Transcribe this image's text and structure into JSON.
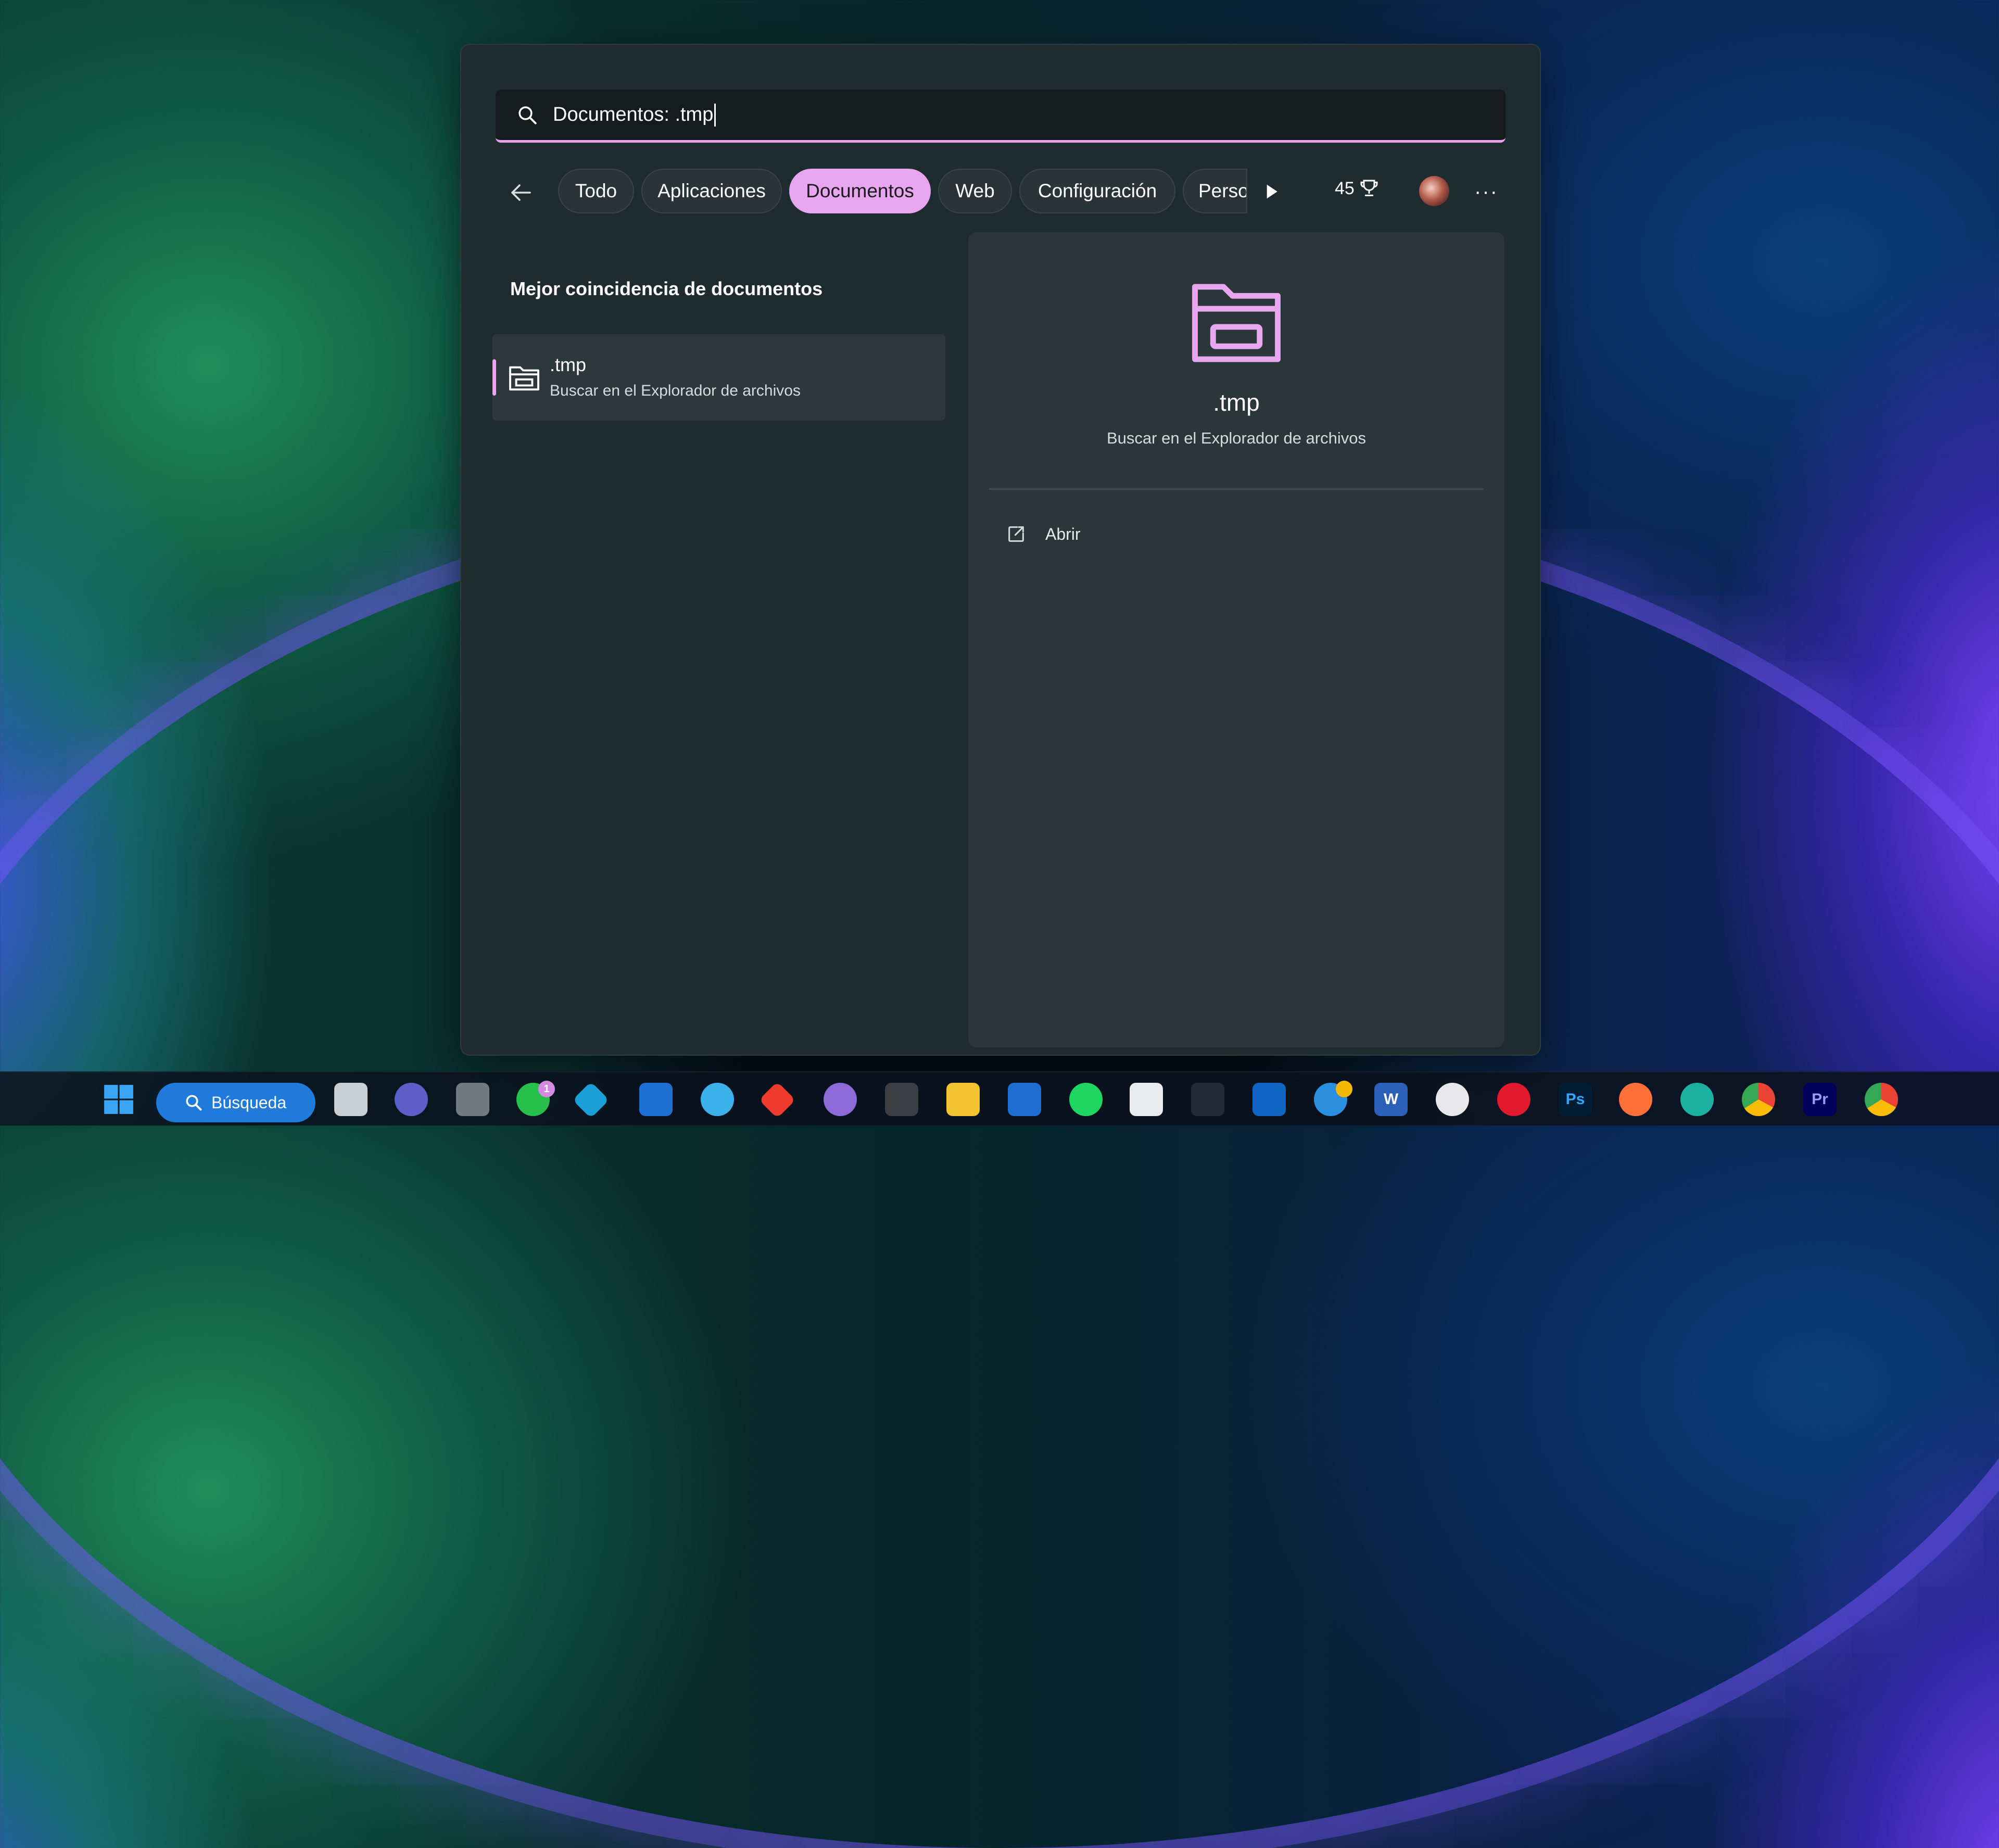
{
  "search": {
    "query": "Documentos: .tmp"
  },
  "filters": {
    "tabs": [
      {
        "label": "Todo",
        "active": false
      },
      {
        "label": "Aplicaciones",
        "active": false
      },
      {
        "label": "Documentos",
        "active": true
      },
      {
        "label": "Web",
        "active": false
      },
      {
        "label": "Configuración",
        "active": false
      },
      {
        "label": "Perso",
        "active": false
      }
    ],
    "points": "45"
  },
  "results": {
    "section_title": "Mejor coincidencia de documentos",
    "best_match": {
      "title": ".tmp",
      "subtitle": "Buscar en el Explorador de archivos"
    }
  },
  "preview": {
    "title": ".tmp",
    "subtitle": "Buscar en el Explorador de archivos",
    "actions": [
      {
        "label": "Abrir",
        "icon": "open-external-icon"
      }
    ]
  },
  "taskbar": {
    "search_label": "Búsqueda",
    "apps": [
      {
        "name": "start",
        "icon": "windows-logo-icon"
      },
      {
        "name": "task-view",
        "icon": "task-view-icon"
      },
      {
        "name": "teams",
        "icon": "video-camera-icon"
      },
      {
        "name": "calculator",
        "icon": "calculator-icon"
      },
      {
        "name": "whatsapp",
        "icon": "whatsapp-icon",
        "badge": "1"
      },
      {
        "name": "kodi",
        "icon": "kodi-icon"
      },
      {
        "name": "notepad",
        "icon": "notepad-icon"
      },
      {
        "name": "paint",
        "icon": "paint-icon"
      },
      {
        "name": "anydesk",
        "icon": "anydesk-icon"
      },
      {
        "name": "bittorrent",
        "icon": "bittorrent-icon"
      },
      {
        "name": "terminal",
        "icon": "terminal-icon"
      },
      {
        "name": "file-explorer",
        "icon": "folder-icon"
      },
      {
        "name": "trello",
        "icon": "trello-icon"
      },
      {
        "name": "spotify",
        "icon": "spotify-icon"
      },
      {
        "name": "store",
        "icon": "store-icon"
      },
      {
        "name": "widgets",
        "icon": "widgets-icon"
      },
      {
        "name": "outlook",
        "icon": "outlook-icon"
      },
      {
        "name": "tips",
        "icon": "help-icon"
      },
      {
        "name": "word",
        "icon": "word-icon",
        "text": "W"
      },
      {
        "name": "slack",
        "icon": "slack-icon"
      },
      {
        "name": "opera",
        "icon": "opera-icon"
      },
      {
        "name": "photoshop",
        "icon": "photoshop-icon",
        "text": "Ps"
      },
      {
        "name": "firefox",
        "icon": "firefox-icon"
      },
      {
        "name": "edge",
        "icon": "edge-icon"
      },
      {
        "name": "chrome",
        "icon": "chrome-icon"
      },
      {
        "name": "premiere",
        "icon": "premiere-icon",
        "text": "Pr"
      },
      {
        "name": "chrome-profile",
        "icon": "chrome-icon"
      }
    ]
  },
  "colors": {
    "accent": "#e7a6ef",
    "panel": "#1f2c2f",
    "taskbar_search": "#1f7ad9"
  }
}
